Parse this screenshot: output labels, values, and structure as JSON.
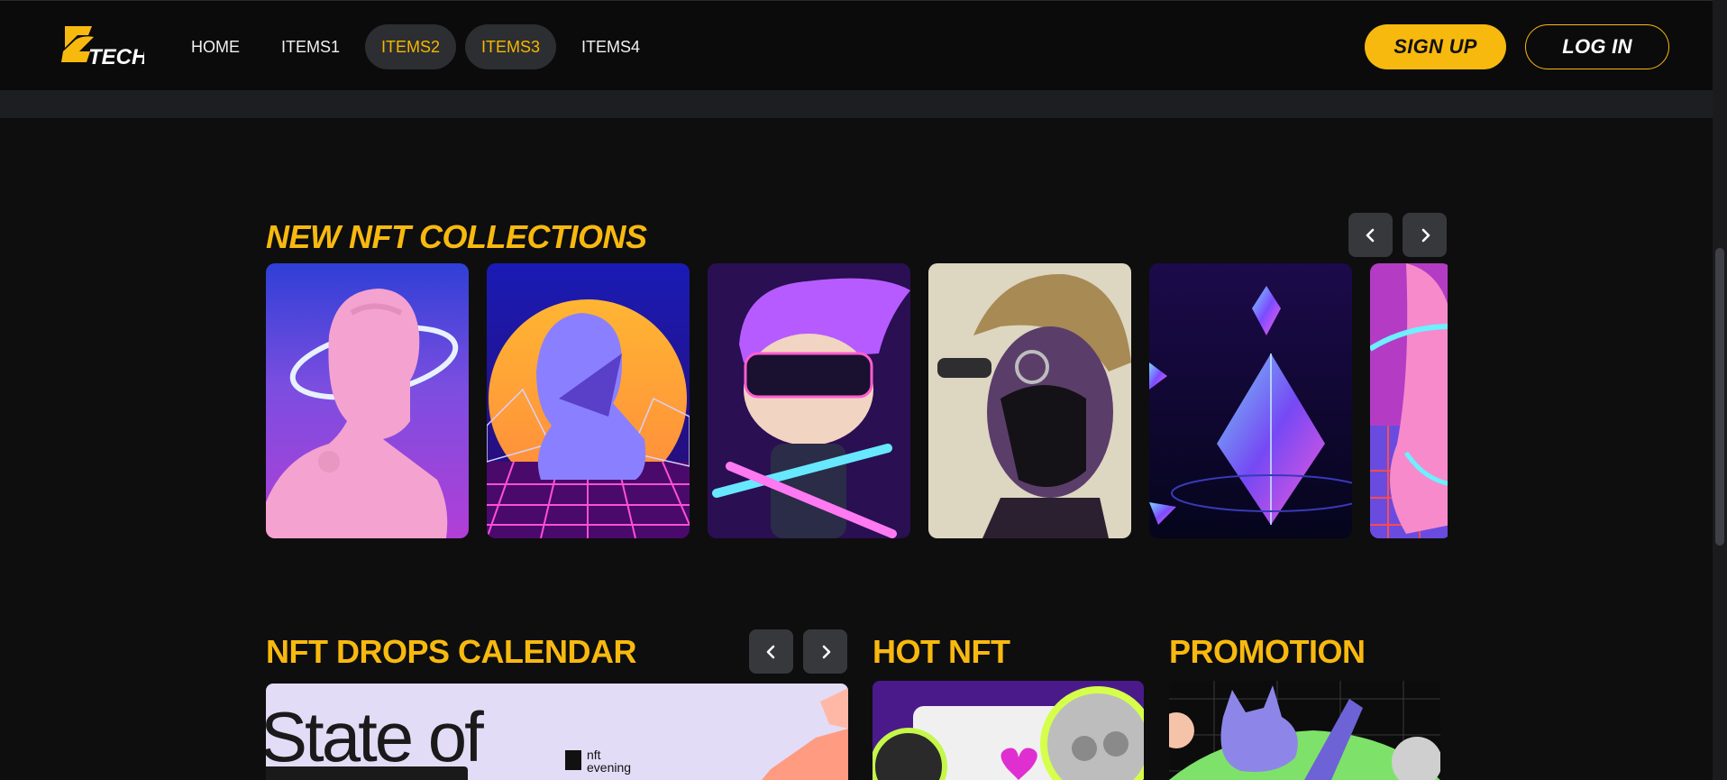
{
  "header": {
    "logo_text": "TECH",
    "nav": [
      {
        "label": "HOME",
        "active": false
      },
      {
        "label": "ITEMS1",
        "active": false
      },
      {
        "label": "ITEMS2",
        "active": true
      },
      {
        "label": "ITEMS3",
        "active": true
      },
      {
        "label": "ITEMS4",
        "active": false
      }
    ],
    "signup_label": "SIGN UP",
    "login_label": "LOG IN"
  },
  "collections": {
    "title": "NEW NFT COLLECTIONS",
    "cards": [
      {
        "name": "nft-card-pink-bust"
      },
      {
        "name": "nft-card-sunset-statue"
      },
      {
        "name": "nft-card-purple-hair-kid"
      },
      {
        "name": "nft-card-hat-mask"
      },
      {
        "name": "nft-card-ethereum-crystal"
      },
      {
        "name": "nft-card-pink-statue-partial"
      }
    ]
  },
  "drops": {
    "title": "NFT DROPS CALENDAR",
    "banner_text": "State of",
    "banner_brand": "nft evening"
  },
  "hot": {
    "title": "HOT NFT"
  },
  "promotion": {
    "title": "PROMOTION"
  },
  "colors": {
    "accent": "#f8b90f",
    "background": "#0e0e0f",
    "header": "#0b0b0c",
    "active_pill": "#2d2e31"
  }
}
